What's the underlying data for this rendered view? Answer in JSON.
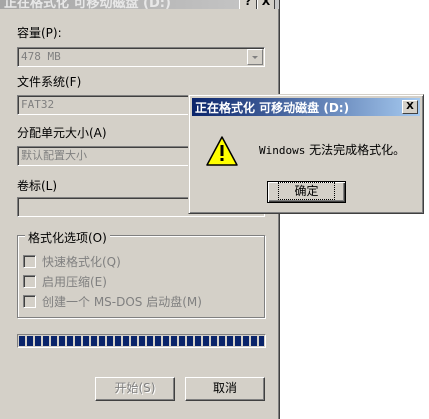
{
  "format_window": {
    "title": "正在格式化 可移动磁盘 (D:)",
    "help_btn": "?",
    "close_btn": "X",
    "capacity": {
      "label": "容量(P):",
      "value": "478 MB"
    },
    "filesystem": {
      "label": "文件系统(F)",
      "value": "FAT32"
    },
    "alloc": {
      "label": "分配单元大小(A)",
      "value": "默认配置大小"
    },
    "volume": {
      "label": "卷标(L)",
      "value": ""
    },
    "options": {
      "legend": "格式化选项(O)",
      "quick": "快速格式化(Q)",
      "compress": "启用压缩(E)",
      "msdos": "创建一个 MS-DOS 启动盘(M)"
    },
    "progress_fraction": 1.0,
    "start_btn": "开始(S)",
    "close_dialog_btn": "取消"
  },
  "message_dialog": {
    "title": "正在格式化 可移动磁盘 (D:)",
    "close_btn": "X",
    "message_prefix": "Windows",
    "message_suffix": " 无法完成格式化。",
    "ok_btn": "确定",
    "icon": "warning-icon"
  },
  "colors": {
    "face": "#d4d0c8",
    "titlebar_active": "#0a246a",
    "progress": "#0a246a"
  }
}
